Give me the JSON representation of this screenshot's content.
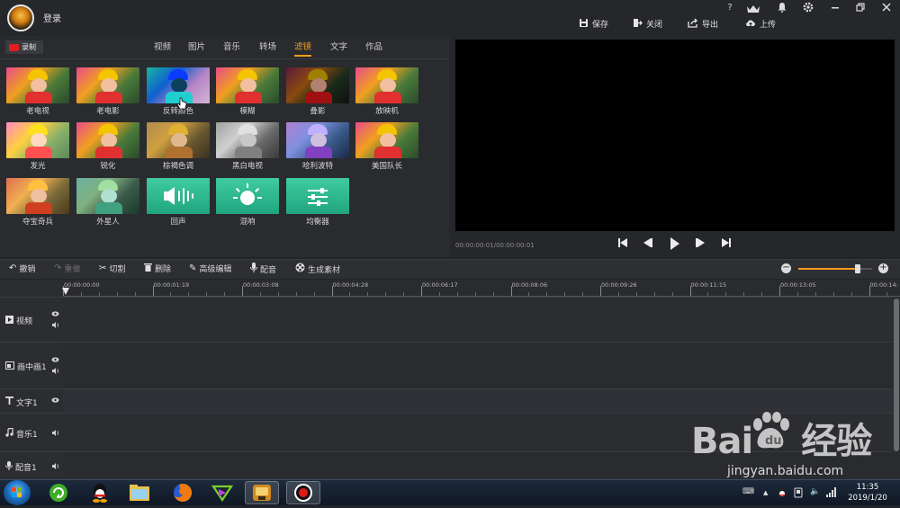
{
  "titlebar": {
    "login": "登录",
    "window_buttons": [
      "?",
      "VIP",
      "bell-icon",
      "gear-icon",
      "minimize-icon",
      "restore-icon",
      "close-icon"
    ],
    "actions": [
      {
        "label": "保存",
        "icon": "save-icon"
      },
      {
        "label": "关闭",
        "icon": "exit-icon"
      },
      {
        "label": "导出",
        "icon": "export-icon"
      },
      {
        "label": "上传",
        "icon": "upload-icon"
      }
    ]
  },
  "media": {
    "record_label": "录制",
    "tabs": [
      "视频",
      "图片",
      "音乐",
      "转场",
      "滤镜",
      "文字",
      "作品"
    ],
    "active_tab": "滤镜",
    "filters": [
      {
        "label": "老电视",
        "palette": "normal"
      },
      {
        "label": "老电影",
        "palette": "normal"
      },
      {
        "label": "反转颜色",
        "palette": "invert"
      },
      {
        "label": "模糊",
        "palette": "normal"
      },
      {
        "label": "叠影",
        "palette": "dark"
      },
      {
        "label": "放映机",
        "palette": "normal"
      },
      {
        "label": "发光",
        "palette": "glow"
      },
      {
        "label": "锐化",
        "palette": "normal"
      },
      {
        "label": "棕褐色调",
        "palette": "sepia"
      },
      {
        "label": "黑白电视",
        "palette": "gray"
      },
      {
        "label": "哈利波特",
        "palette": "cool"
      },
      {
        "label": "美国队长",
        "palette": "normal"
      },
      {
        "label": "夺宝奇兵",
        "palette": "warm"
      },
      {
        "label": "外星人",
        "palette": "alien"
      },
      {
        "label": "回声",
        "palette": "echo"
      },
      {
        "label": "混响",
        "palette": "reverb"
      },
      {
        "label": "均衡器",
        "palette": "eq"
      }
    ]
  },
  "preview": {
    "timecode": "00:00:00:01/00:00:00:01",
    "controls": [
      "skip-start-icon",
      "step-back-icon",
      "play-icon",
      "step-forward-icon",
      "skip-end-icon"
    ]
  },
  "toolbar": {
    "items": [
      {
        "label": "撤销",
        "icon": "undo-icon",
        "enabled": true
      },
      {
        "label": "重做",
        "icon": "redo-icon",
        "enabled": false
      },
      {
        "label": "切割",
        "icon": "scissors-icon",
        "enabled": true
      },
      {
        "label": "删除",
        "icon": "trash-icon",
        "enabled": true
      },
      {
        "label": "高级编辑",
        "icon": "pencil-icon",
        "enabled": true
      },
      {
        "label": "配音",
        "icon": "microphone-icon",
        "enabled": true
      },
      {
        "label": "生成素材",
        "icon": "reel-icon",
        "enabled": true
      }
    ],
    "zoom_level": 0.8
  },
  "timeline": {
    "ticks": [
      "00:00:00:00",
      "00:00:01:19",
      "00:00:03:08",
      "00:00:04:28",
      "00:00:06:17",
      "00:00:08:06",
      "00:00:09:26",
      "00:00:11:15",
      "00:00:13:05",
      "00:00:14:"
    ],
    "tracks": [
      {
        "label": "视频",
        "icon": "video-icon",
        "eye": true,
        "sound": true
      },
      {
        "label": "画中画1",
        "icon": "pip-icon",
        "eye": true,
        "sound": true
      },
      {
        "label": "文字1",
        "icon": "text-icon",
        "eye": true,
        "sound": false
      },
      {
        "label": "音乐1",
        "icon": "music-icon",
        "eye": false,
        "sound": true
      },
      {
        "label": "配音1",
        "icon": "microphone-icon",
        "eye": false,
        "sound": true
      }
    ]
  },
  "taskbar": {
    "apps": [
      "refresh-app-icon",
      "qq-penguin-icon",
      "file-explorer-icon",
      "firefox-icon",
      "media-player-icon",
      "video-editor-icon",
      "recorder-icon"
    ],
    "clock_time": "11:35",
    "clock_date": "2019/1/20"
  },
  "watermark": {
    "brand": "Bai",
    "brand_suffix": "经验",
    "url": "jingyan.baidu.com"
  }
}
